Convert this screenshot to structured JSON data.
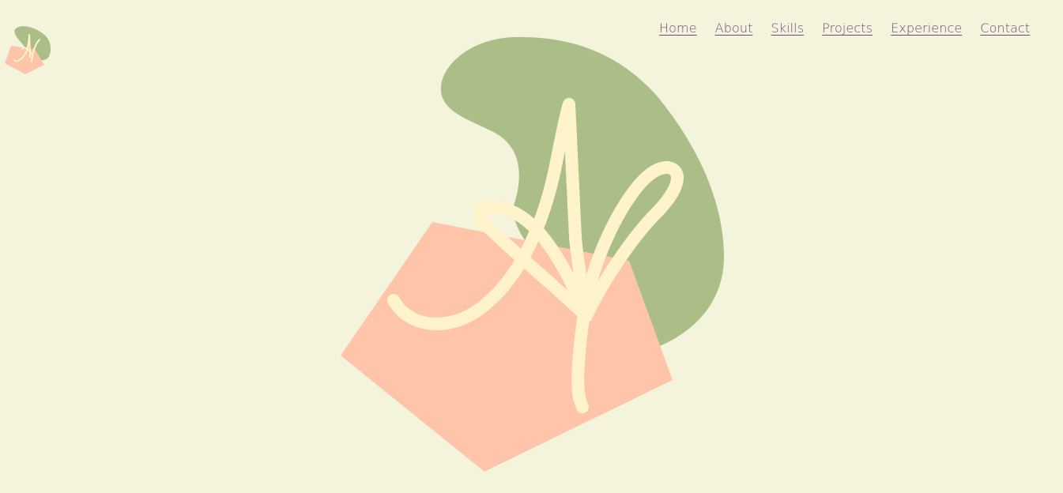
{
  "header": {
    "logo_icon": "monogram-logo-icon",
    "nav": [
      {
        "label": "Home"
      },
      {
        "label": "About"
      },
      {
        "label": "Skills"
      },
      {
        "label": "Projects"
      },
      {
        "label": "Experience"
      },
      {
        "label": "Contact"
      }
    ]
  },
  "hero": {
    "illustration_icon": "monogram-illustration",
    "colors": {
      "background": "#f4f4dc",
      "blob": "#acbe88",
      "pentagon": "#fec5aa",
      "stroke": "#fff3cc",
      "nav_link": "#6a4a78"
    }
  }
}
